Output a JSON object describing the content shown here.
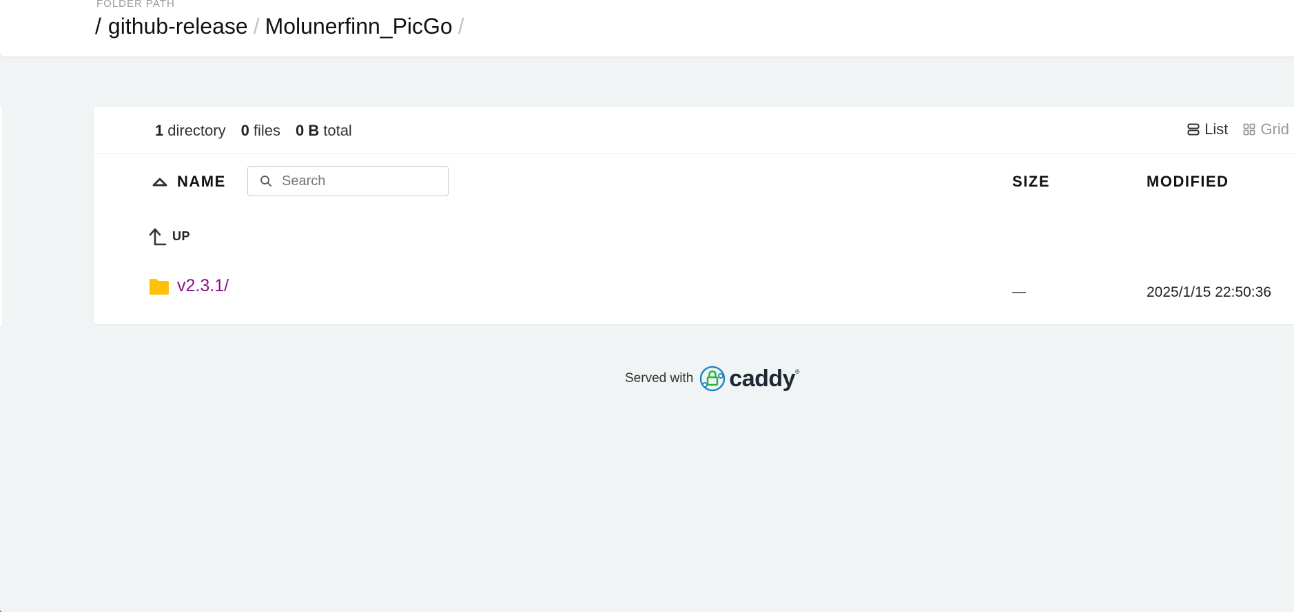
{
  "header": {
    "folder_label": "FOLDER PATH",
    "root_sep": "/",
    "path": [
      {
        "label": "github-release",
        "sep": "/"
      },
      {
        "label": "Molunerfinn_PicGo",
        "sep": "/"
      }
    ]
  },
  "summary": {
    "dir_count": "1",
    "dir_label": "directory",
    "file_count": "0",
    "file_label": "files",
    "total_size": "0 B",
    "total_label": "total"
  },
  "view": {
    "list_label": "List",
    "grid_label": "Grid",
    "active": "list"
  },
  "table": {
    "name_header": "NAME",
    "size_header": "SIZE",
    "modified_header": "MODIFIED",
    "search_placeholder": "Search",
    "up_label": "UP",
    "rows": [
      {
        "name": "v2.3.1/",
        "size": "—",
        "modified": "2025/1/15 22:50:36",
        "type": "folder-icon"
      }
    ]
  },
  "footer": {
    "served_with": "Served with",
    "brand": "caddy"
  },
  "colors": {
    "background": "#f1f4f5",
    "link_visited": "#8a0f8c",
    "folder": "#ffc107"
  }
}
